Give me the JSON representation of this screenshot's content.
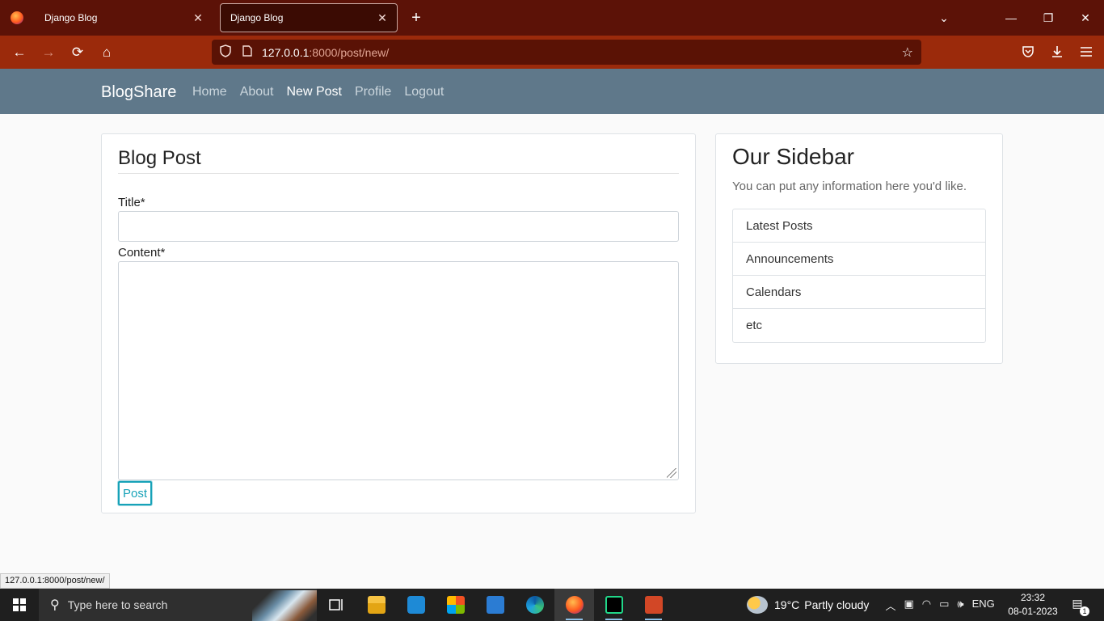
{
  "browser": {
    "tabs": [
      {
        "title": "Django Blog",
        "close": "✕"
      },
      {
        "title": "Django Blog",
        "close": "✕"
      }
    ],
    "new_tab": "+",
    "tab_list": "⌄",
    "window_controls": {
      "minimize": "—",
      "restore": "❐",
      "close": "✕"
    },
    "nav": {
      "back": "←",
      "forward": "→",
      "reload": "⟳",
      "home": "⌂"
    },
    "url_host": "127.0.0.1",
    "url_rest": ":8000/post/new/",
    "status_url": "127.0.0.1:8000/post/new/"
  },
  "site": {
    "brand": "BlogShare",
    "nav": [
      "Home",
      "About",
      "New Post",
      "Profile",
      "Logout"
    ],
    "active_nav": "New Post"
  },
  "form": {
    "legend": "Blog Post",
    "title_label": "Title*",
    "title_value": "",
    "content_label": "Content*",
    "content_value": "",
    "submit_label": "Post"
  },
  "sidebar": {
    "title": "Our Sidebar",
    "text": "You can put any information here you'd like.",
    "items": [
      "Latest Posts",
      "Announcements",
      "Calendars",
      "etc"
    ]
  },
  "taskbar": {
    "search_placeholder": "Type here to search",
    "weather_temp": "19°C",
    "weather_desc": "Partly cloudy",
    "language": "ENG",
    "time": "23:32",
    "date": "08-01-2023",
    "notification_count": "1"
  },
  "colors": {
    "tab_bar": "#5c1207",
    "toolbar": "#9b2a0b",
    "site_nav": "#5f788a",
    "accent_info": "#17a2b8"
  }
}
